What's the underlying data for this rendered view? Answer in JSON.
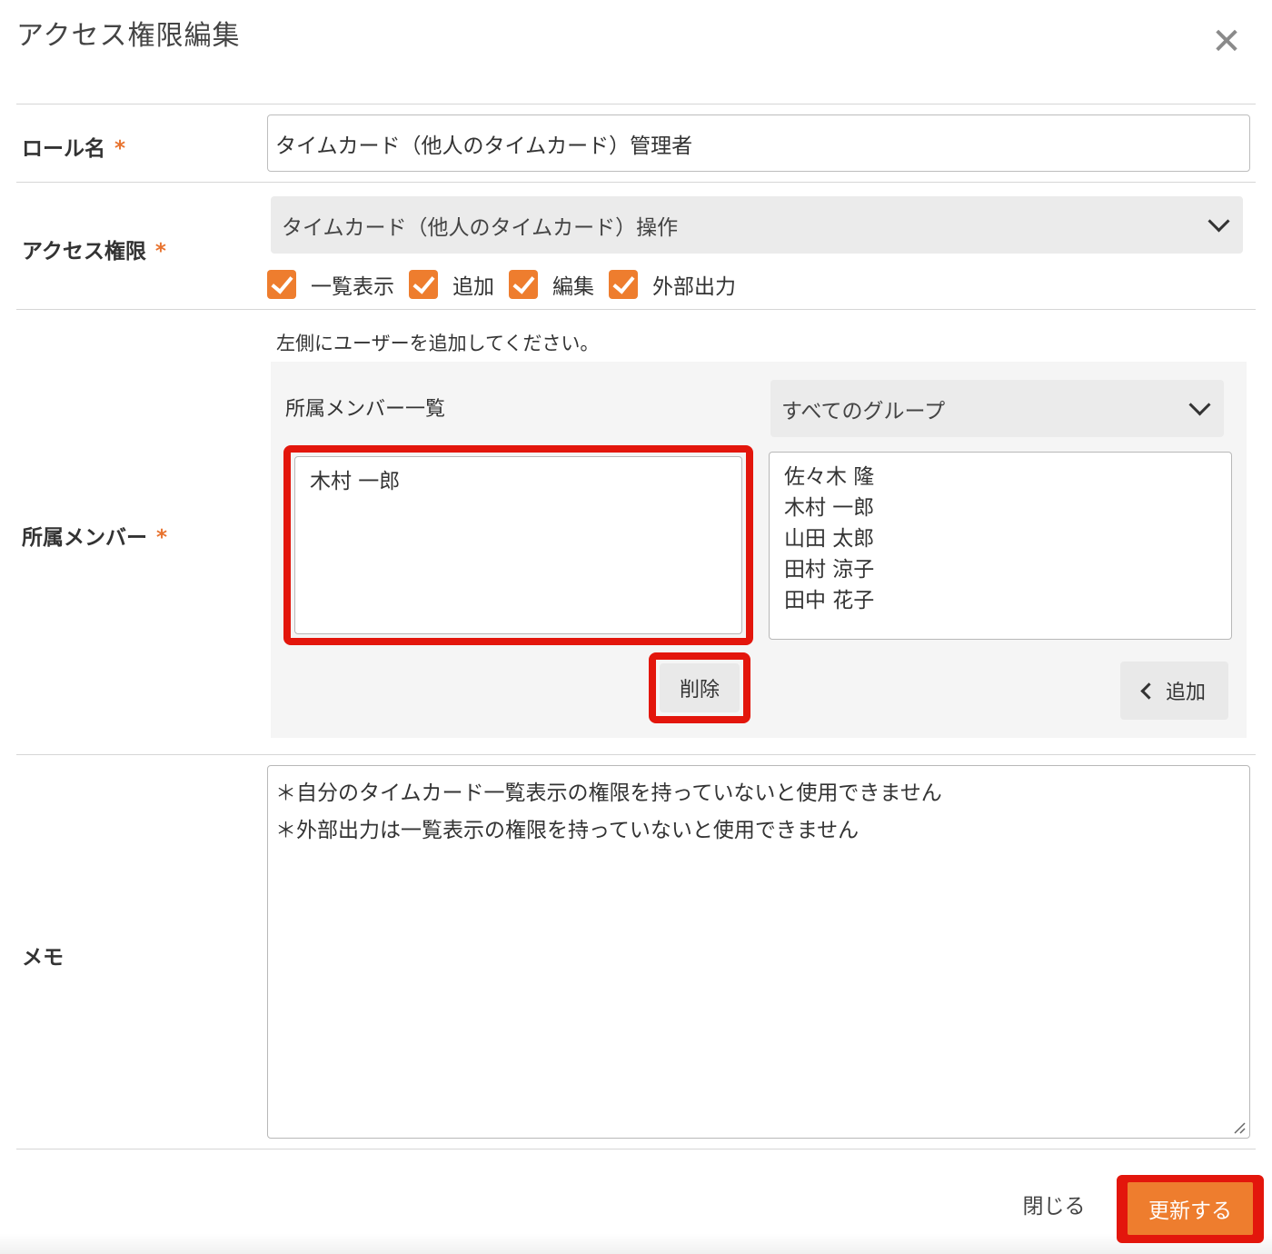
{
  "dialog": {
    "title": "アクセス権限編集"
  },
  "role": {
    "label": "ロール名",
    "required_mark": "*",
    "value": "タイムカード（他人のタイムカード）管理者"
  },
  "access": {
    "label": "アクセス権限",
    "required_mark": "*",
    "selected": "タイムカード（他人のタイムカード）操作",
    "checkboxes": [
      {
        "label": "一覧表示",
        "checked": true
      },
      {
        "label": "追加",
        "checked": true
      },
      {
        "label": "編集",
        "checked": true
      },
      {
        "label": "外部出力",
        "checked": true
      }
    ]
  },
  "members": {
    "label": "所属メンバー",
    "required_mark": "*",
    "hint": "左側にユーザーを追加してください。",
    "list_title": "所属メンバー一覧",
    "group_selected": "すべてのグループ",
    "assigned": [
      "木村 一郎"
    ],
    "available": [
      "佐々木 隆",
      "木村 一郎",
      "山田 太郎",
      "田村 涼子",
      "田中 花子"
    ],
    "remove_label": "削除",
    "add_label": "追加"
  },
  "memo": {
    "label": "メモ",
    "lines": [
      "＊自分のタイムカード一覧表示の権限を持っていないと使用できません",
      "＊外部出力は一覧表示の権限を持っていないと使用できません"
    ]
  },
  "footer": {
    "close_label": "閉じる",
    "update_label": "更新する"
  },
  "colors": {
    "accent": "#ee7d2e",
    "highlight": "#e3160c"
  }
}
